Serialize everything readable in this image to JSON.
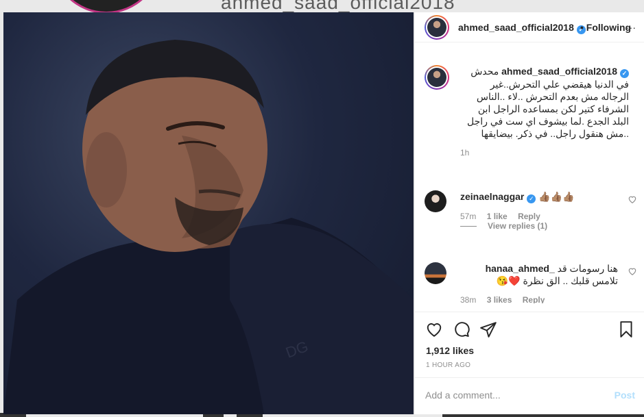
{
  "background": {
    "username_watermark": "ahmed_saad_official2018"
  },
  "post": {
    "header": {
      "username": "ahmed_saad_official2018",
      "verified_icon": "verified-badge-icon",
      "following_label": "• Following",
      "more_icon": "more-dots-icon"
    },
    "caption": {
      "username": "ahmed_saad_official2018",
      "text": "محدش في الدنيا هيقضي علي التحرش..غير الرجاله مش بعدم التحرش ..لاء ..الناس الشرفاء كتير لكن بمساعده الراجل ابن البلد الجدع .لما بيشوف اي ست في راجل ..مش هنقول راجل.. في ذكر. بيضايقها",
      "time": "1h"
    },
    "comments": [
      {
        "username": "zeinaelnaggar",
        "verified": true,
        "text": "👍🏽👍🏽👍🏽",
        "time": "57m",
        "likes": "1 like",
        "reply_label": "Reply",
        "view_replies": "View replies (1)"
      },
      {
        "username": "_hanaa_ahmed",
        "text_rtl": "هنا رسومات قد",
        "line2": "تلامس قلبك .. الق نظرة ❤️😘",
        "time": "38m",
        "likes": "3 likes",
        "reply_label": "Reply"
      }
    ],
    "actions": {
      "like_icon": "heart-icon",
      "comment_icon": "comment-icon",
      "share_icon": "share-icon",
      "save_icon": "bookmark-icon"
    },
    "likes_count": "1,912 likes",
    "posted_ago": "1 HOUR AGO",
    "add_comment": {
      "placeholder": "Add a comment...",
      "post_label": "Post"
    }
  },
  "colors": {
    "accent_blue": "#3897f0",
    "post_disabled": "#b2dffc",
    "text_primary": "#262626",
    "text_secondary": "#8e8e8e"
  }
}
